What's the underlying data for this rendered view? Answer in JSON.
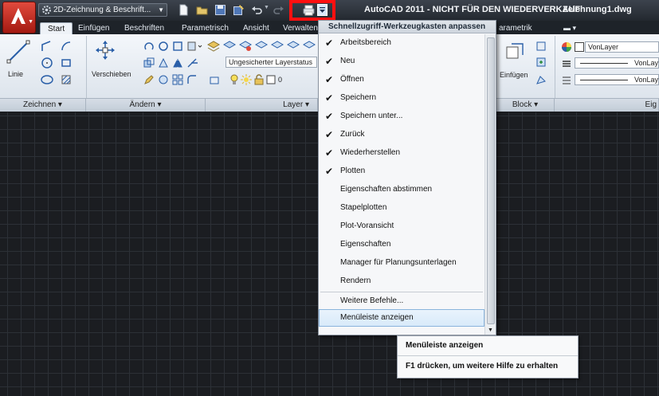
{
  "title_bar": {
    "workspace": "2D-Zeichnung & Beschrift...",
    "app_title": "AutoCAD 2011 - NICHT FÜR DEN WIEDERVERKAUF",
    "drawing_name": "Zeichnung1.dwg",
    "highlight_color": "#ff1010"
  },
  "tabs": [
    "Start",
    "Einfügen",
    "Beschriften",
    "Parametrisch",
    "Ansicht",
    "Verwalten"
  ],
  "tab_tail": "arametrik",
  "ribbon": {
    "line_label": "Linie",
    "move_label": "Verschieben",
    "insert_label": "Einfügen",
    "layer_state": "Ungesicherter Layerstatus",
    "layer_current": "0",
    "color_value": "VonLayer",
    "linetype_value": "VonLay",
    "lineweight_value": "VonLay",
    "panels": {
      "draw": "Zeichnen",
      "modify": "Ändern",
      "layer": "Layer",
      "block": "Block",
      "properties": "Eig"
    }
  },
  "menu": {
    "header": "Schnellzugriff-Werkzeugkasten anpassen",
    "items": [
      {
        "label": "Arbeitsbereich",
        "check": "✔"
      },
      {
        "label": "Neu",
        "check": "✔"
      },
      {
        "label": "Öffnen",
        "check": "✔"
      },
      {
        "label": "Speichern",
        "check": "✔"
      },
      {
        "label": "Speichern unter...",
        "check": "✔"
      },
      {
        "label": "Zurück",
        "check": "✔"
      },
      {
        "label": "Wiederherstellen",
        "check": "✔"
      },
      {
        "label": "Plotten",
        "check": "✔"
      },
      {
        "label": "Eigenschaften abstimmen",
        "check": ""
      },
      {
        "label": "Stapelplotten",
        "check": ""
      },
      {
        "label": "Plot-Voransicht",
        "check": ""
      },
      {
        "label": "Eigenschaften",
        "check": ""
      },
      {
        "label": "Manager für Planungsunterlagen",
        "check": ""
      },
      {
        "label": "Rendern",
        "check": ""
      }
    ],
    "more_commands": "Weitere Befehle...",
    "show_menubar": "Menüleiste anzeigen"
  },
  "tooltip": {
    "title": "Menüleiste anzeigen",
    "help": "F1 drücken, um weitere Hilfe zu erhalten"
  }
}
